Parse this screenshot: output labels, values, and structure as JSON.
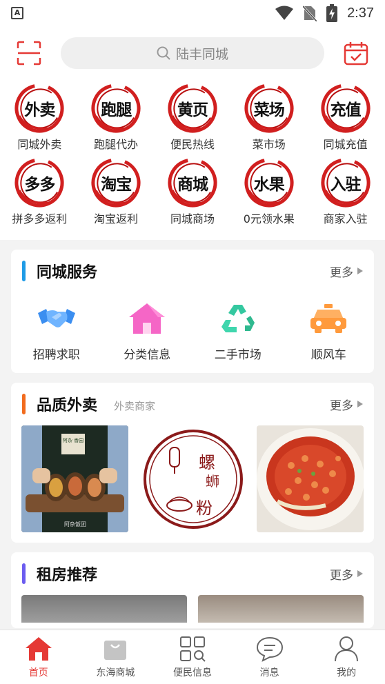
{
  "status_bar": {
    "time": "2:37"
  },
  "header": {
    "search_placeholder": "陆丰同城"
  },
  "grid": [
    {
      "badge": "外卖",
      "label": "同城外卖"
    },
    {
      "badge": "跑腿",
      "label": "跑腿代办"
    },
    {
      "badge": "黄页",
      "label": "便民热线"
    },
    {
      "badge": "菜场",
      "label": "菜市场"
    },
    {
      "badge": "充值",
      "label": "同城充值"
    },
    {
      "badge": "多多",
      "label": "拼多多返利"
    },
    {
      "badge": "淘宝",
      "label": "淘宝返利"
    },
    {
      "badge": "商城",
      "label": "同城商场"
    },
    {
      "badge": "水果",
      "label": "0元领水果"
    },
    {
      "badge": "入驻",
      "label": "商家入驻"
    }
  ],
  "services": {
    "title": "同城服务",
    "more": "更多",
    "accent": "#1e9be6",
    "items": [
      {
        "label": "招聘求职",
        "icon": "handshake-icon"
      },
      {
        "label": "分类信息",
        "icon": "house-icon"
      },
      {
        "label": "二手市场",
        "icon": "recycle-icon"
      },
      {
        "label": "顺风车",
        "icon": "taxi-icon"
      }
    ]
  },
  "food": {
    "title": "品质外卖",
    "subtitle": "外卖商家",
    "more": "更多",
    "accent": "#f26b1d",
    "images": [
      {
        "name": "rolls-photo",
        "shop_sign": "阿杂 香园",
        "footer": "阿杂饭团"
      },
      {
        "name": "luosifen-logo",
        "chars": [
          "螺",
          "蛳",
          "粉"
        ]
      },
      {
        "name": "noodle-photo"
      }
    ]
  },
  "rent": {
    "title": "租房推荐",
    "more": "更多",
    "accent": "#6b5cf0"
  },
  "tabbar": [
    {
      "label": "首页",
      "icon": "home-icon",
      "active": true
    },
    {
      "label": "东海商城",
      "icon": "shopping-bag-icon",
      "active": false
    },
    {
      "label": "便民信息",
      "icon": "grid-search-icon",
      "active": false
    },
    {
      "label": "消息",
      "icon": "chat-bubble-icon",
      "active": false
    },
    {
      "label": "我的",
      "icon": "user-icon",
      "active": false
    }
  ]
}
